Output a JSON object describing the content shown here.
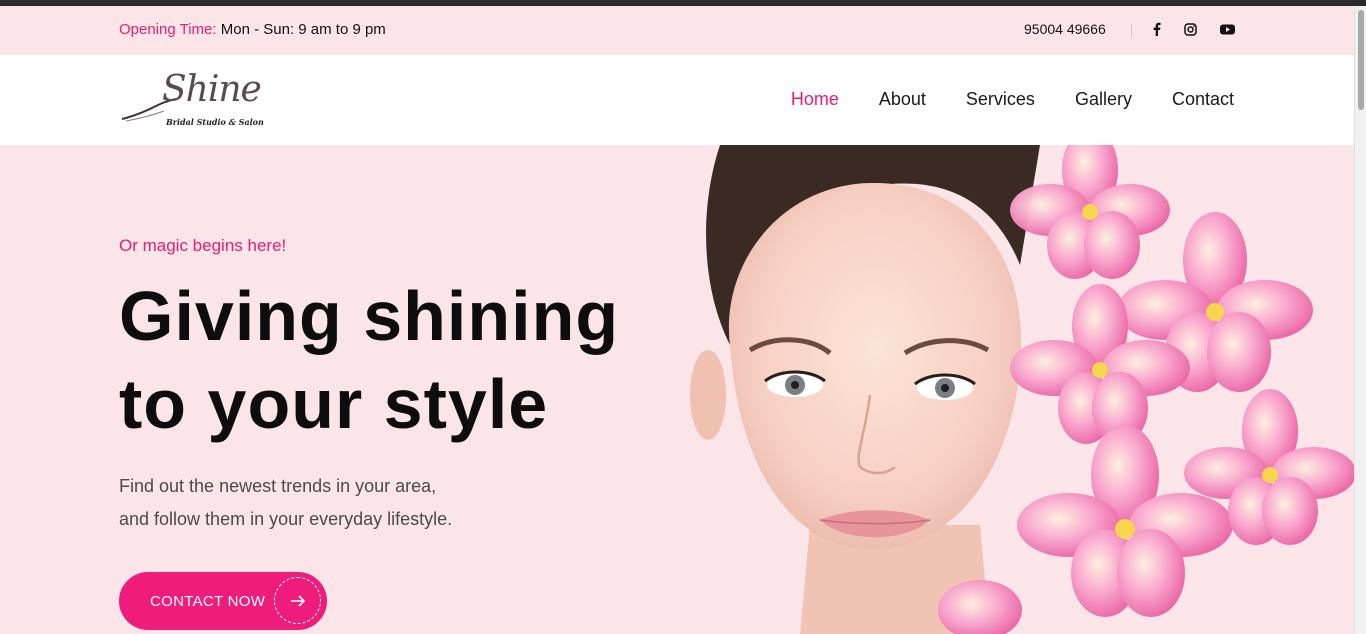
{
  "topbar": {
    "hours_label": "Opening Time:",
    "hours_value": " Mon - Sun: 9 am to 9 pm",
    "phone": "95004 49666",
    "social": [
      "facebook-icon",
      "instagram-icon",
      "youtube-icon"
    ]
  },
  "brand": {
    "name": "Shine",
    "tagline": "Bridal Studio & Salon"
  },
  "nav": {
    "items": [
      "Home",
      "About",
      "Services",
      "Gallery",
      "Contact"
    ],
    "active": "Home"
  },
  "hero": {
    "eyebrow": "Or magic begins here!",
    "headline_line1": "Giving shining",
    "headline_line2": "to your style",
    "desc_line1": "Find out the newest trends in your area,",
    "desc_line2": "and follow them in your everyday lifestyle.",
    "cta_label": "CONTACT NOW",
    "cta_icon": "arrow-right-icon"
  },
  "colors": {
    "accent": "#e91e73",
    "background": "#fbe5e8",
    "button": "#f01c7b"
  }
}
